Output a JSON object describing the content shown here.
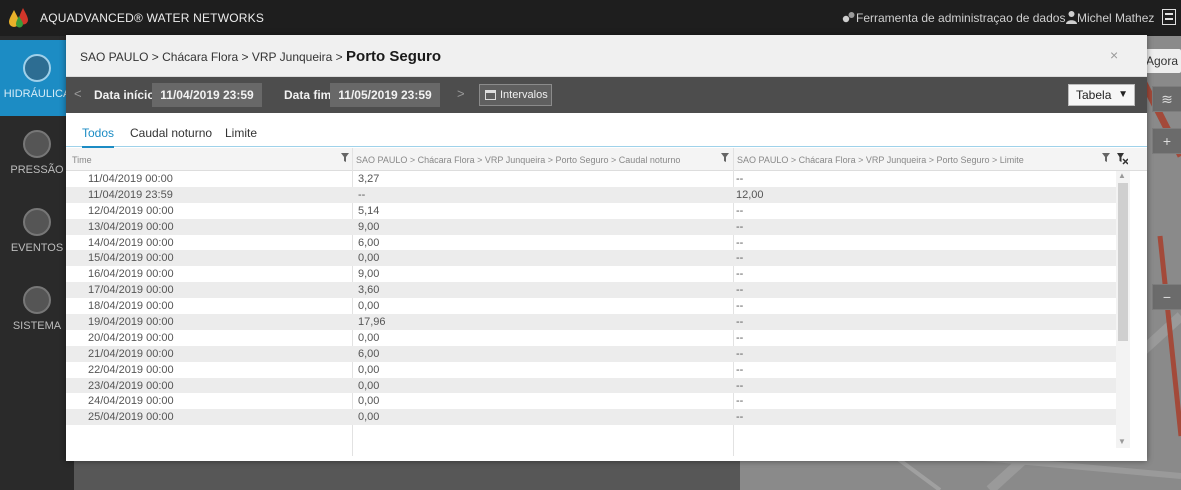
{
  "app": {
    "title": "AQUADVANCED® WATER NETWORKS",
    "admin_link": "Ferramenta de administraçao de dados",
    "user": "Michel Mathez"
  },
  "nav": [
    {
      "label": "HIDRÁULICA",
      "active": true
    },
    {
      "label": "PRESSÃO",
      "active": false
    },
    {
      "label": "EVENTOS",
      "active": false
    },
    {
      "label": "SISTEMA",
      "active": false
    }
  ],
  "map": {
    "now_button": "Agora"
  },
  "modal": {
    "breadcrumb_path": "SAO PAULO > Chácara Flora > VRP Junqueira > ",
    "breadcrumb_current": "Porto Seguro",
    "close": "×",
    "start_label": "Data início",
    "start_value": "11/04/2019 23:59",
    "end_label": "Data fim",
    "end_value": "11/05/2019 23:59",
    "intervals_label": "Intervalos",
    "view_select": "Tabela",
    "tabs": [
      "Todos",
      "Caudal noturno",
      "Limite"
    ],
    "columns": [
      "Time",
      "SAO PAULO > Chácara Flora > VRP Junqueira > Porto Seguro > Caudal noturno",
      "SAO PAULO > Chácara Flora > VRP Junqueira > Porto Seguro > Limite"
    ],
    "rows": [
      [
        "11/04/2019 00:00",
        "3,27",
        "--"
      ],
      [
        "11/04/2019 23:59",
        "--",
        "12,00"
      ],
      [
        "12/04/2019 00:00",
        "5,14",
        "--"
      ],
      [
        "13/04/2019 00:00",
        "9,00",
        "--"
      ],
      [
        "14/04/2019 00:00",
        "6,00",
        "--"
      ],
      [
        "15/04/2019 00:00",
        "0,00",
        "--"
      ],
      [
        "16/04/2019 00:00",
        "9,00",
        "--"
      ],
      [
        "17/04/2019 00:00",
        "3,60",
        "--"
      ],
      [
        "18/04/2019 00:00",
        "0,00",
        "--"
      ],
      [
        "19/04/2019 00:00",
        "17,96",
        "--"
      ],
      [
        "20/04/2019 00:00",
        "0,00",
        "--"
      ],
      [
        "21/04/2019 00:00",
        "6,00",
        "--"
      ],
      [
        "22/04/2019 00:00",
        "0,00",
        "--"
      ],
      [
        "23/04/2019 00:00",
        "0,00",
        "--"
      ],
      [
        "24/04/2019 00:00",
        "0,00",
        "--"
      ],
      [
        "25/04/2019 00:00",
        "0,00",
        "--"
      ]
    ]
  },
  "colors": {
    "accent": "#1c8cc4",
    "topbar": "#1e1e1e",
    "toolbar": "#4d4d4d"
  }
}
